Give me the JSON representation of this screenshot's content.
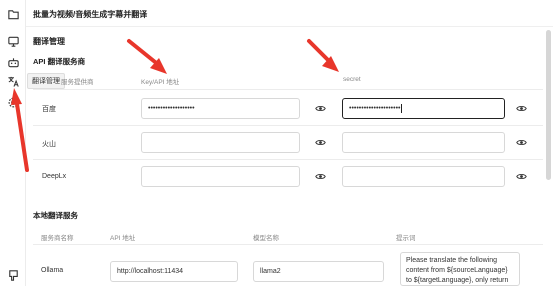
{
  "app": {
    "title": "批量为视频/音频生成字幕并翻译"
  },
  "sidebar": {
    "tooltip": "翻译管理",
    "icons": [
      "folder-icon",
      "monitor-icon",
      "bot-icon",
      "translate-icon",
      "gear-icon",
      "help-icon"
    ]
  },
  "page": {
    "title": "翻译管理",
    "api_section": {
      "title": "API 翻译服务商",
      "headers": {
        "provider": "服务提供商",
        "key": "Key/API 地址",
        "secret": "secret"
      },
      "rows": [
        {
          "name": "百度",
          "key": "•••••••••••••••••••",
          "secret": "•••••••••••••••••••••",
          "secret_focused": true
        },
        {
          "name": "火山",
          "key": "",
          "secret": "",
          "secret_focused": false
        },
        {
          "name": "DeepLx",
          "key": "",
          "secret": "",
          "secret_focused": false
        }
      ]
    },
    "local_section": {
      "title": "本地翻译服务",
      "headers": {
        "name": "服务商名称",
        "api": "API 地址",
        "model": "模型名称",
        "prompt": "提示词"
      },
      "rows": [
        {
          "name": "Ollama",
          "api": "http://localhost:11434",
          "model": "llama2",
          "prompt": "Please translate the following content from ${sourceLanguage} to ${targetLanguage}, only return the"
        }
      ]
    }
  },
  "colors": {
    "annotation_arrow": "#e8362b",
    "focus_border": "#222222"
  }
}
